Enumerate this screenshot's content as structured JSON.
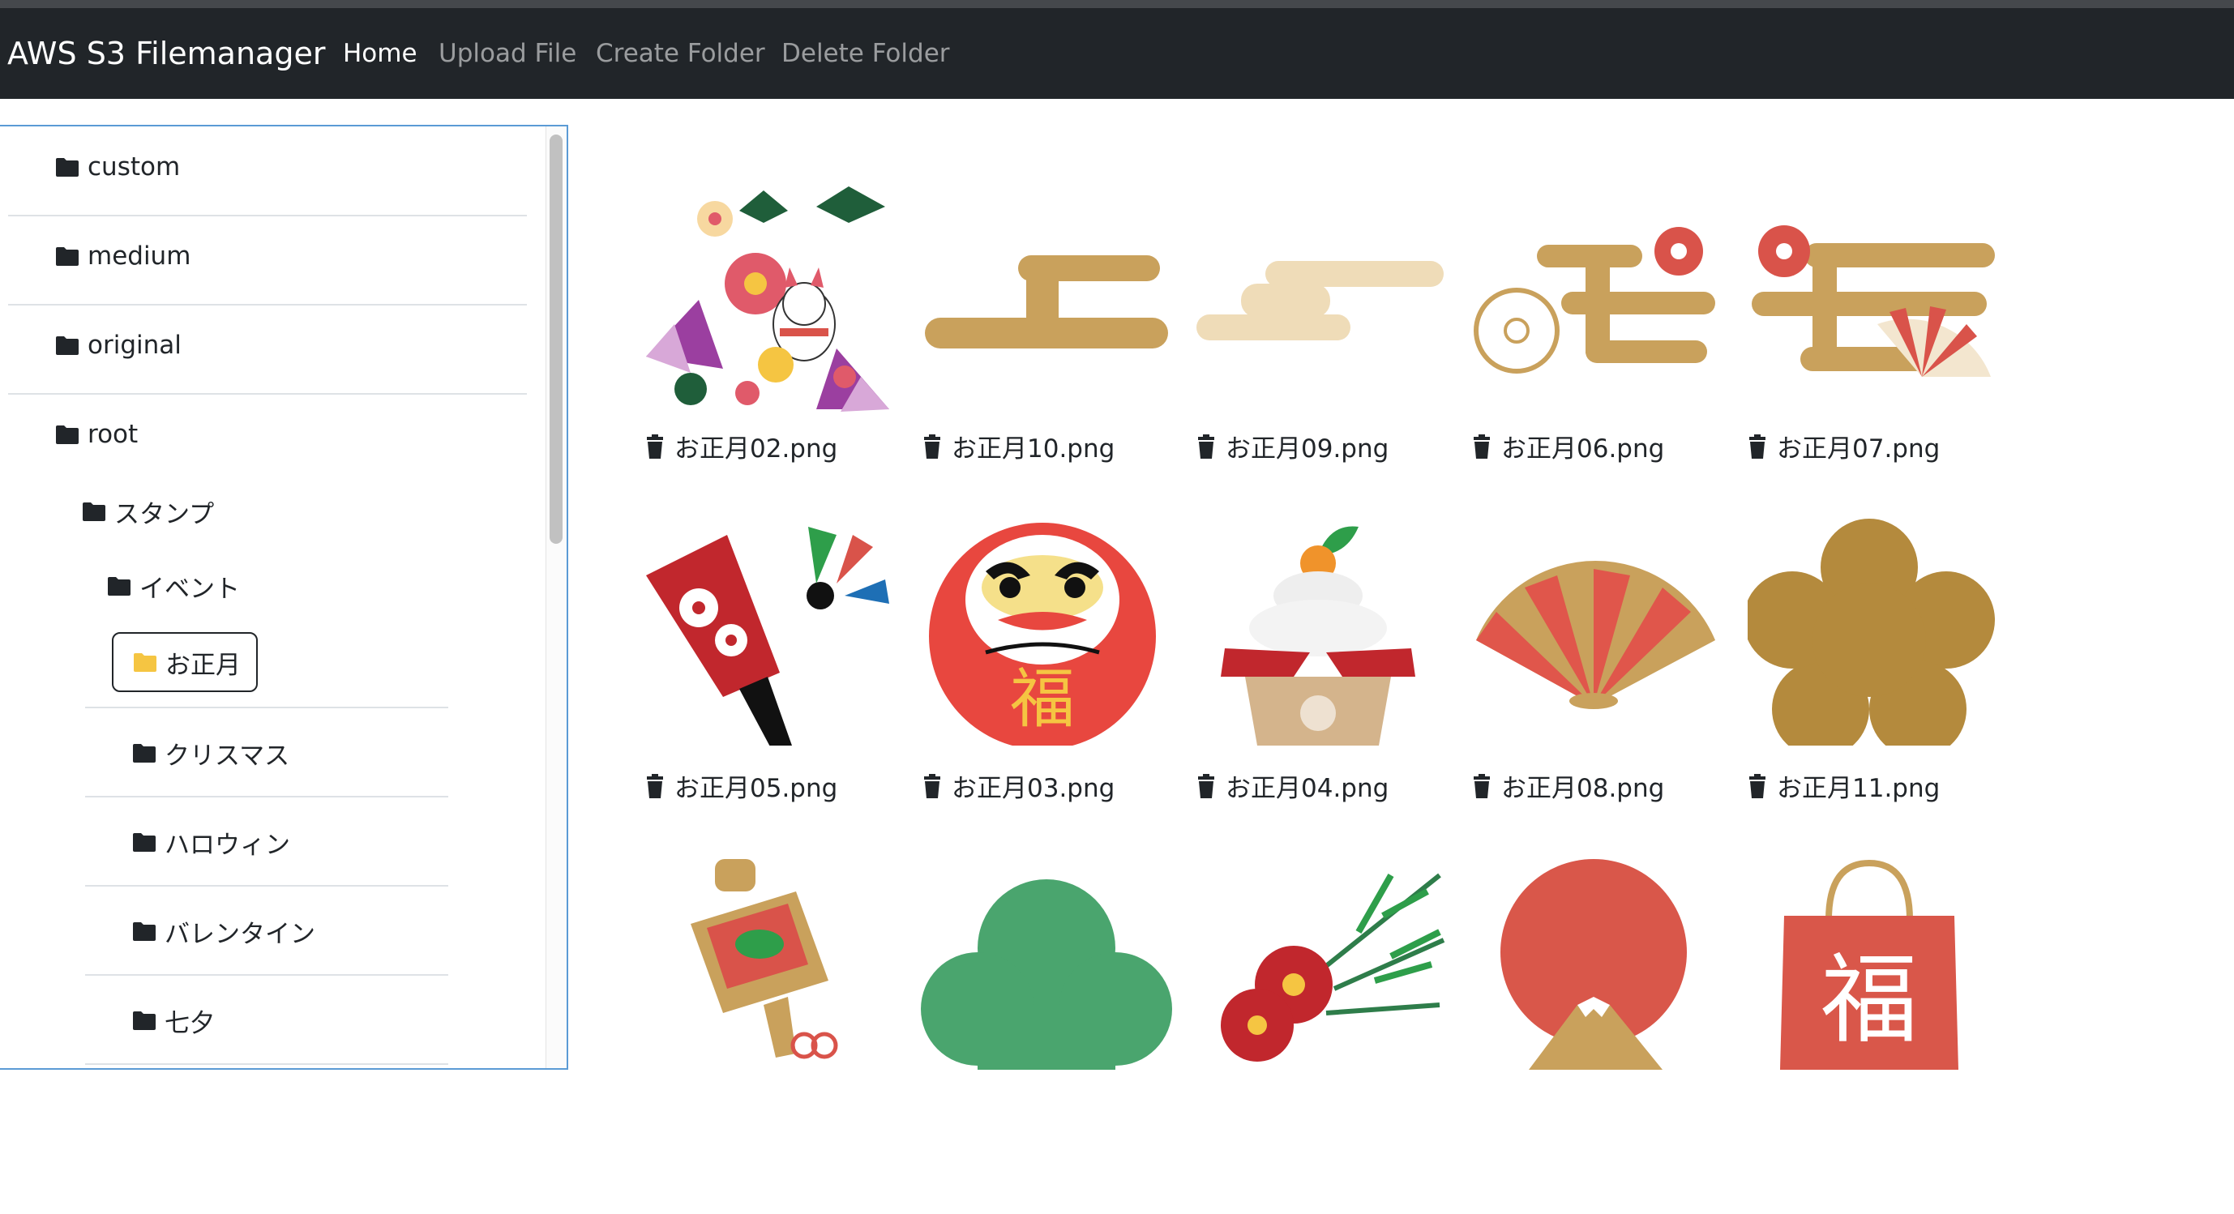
{
  "navbar": {
    "brand": "AWS S3 Filemanager",
    "links": [
      {
        "label": "Home",
        "active": true
      },
      {
        "label": "Upload File",
        "active": false
      },
      {
        "label": "Create Folder",
        "active": false
      },
      {
        "label": "Delete Folder",
        "active": false
      }
    ]
  },
  "sidebar": {
    "folders": [
      {
        "label": "custom",
        "icon": "folder-icon"
      },
      {
        "label": "medium",
        "icon": "folder-icon"
      },
      {
        "label": "original",
        "icon": "folder-icon"
      },
      {
        "label": "root",
        "icon": "folder-icon"
      },
      {
        "label": "スタンプ",
        "icon": "folder-icon"
      },
      {
        "label": "イベント",
        "icon": "folder-icon"
      },
      {
        "label": "お正月",
        "icon": "folder-open-icon",
        "selected": true
      },
      {
        "label": "クリスマス",
        "icon": "folder-icon"
      },
      {
        "label": "ハロウィン",
        "icon": "folder-icon"
      },
      {
        "label": "バレンタイン",
        "icon": "folder-icon"
      },
      {
        "label": "七夕",
        "icon": "folder-icon"
      }
    ]
  },
  "files": [
    {
      "name": "お正月02.png",
      "image": "new-year-collage-icon"
    },
    {
      "name": "お正月10.png",
      "image": "gold-cloud-icon"
    },
    {
      "name": "お正月09.png",
      "image": "beige-cloud-icon"
    },
    {
      "name": "お正月06.png",
      "image": "cloud-plum-icon"
    },
    {
      "name": "お正月07.png",
      "image": "cloud-fan-icon"
    },
    {
      "name": "お正月05.png",
      "image": "hagoita-icon"
    },
    {
      "name": "お正月03.png",
      "image": "daruma-icon"
    },
    {
      "name": "お正月04.png",
      "image": "kagami-mochi-icon"
    },
    {
      "name": "お正月08.png",
      "image": "folding-fan-icon"
    },
    {
      "name": "お正月11.png",
      "image": "plum-blossom-icon"
    },
    {
      "name": "",
      "image": "lucky-mallet-icon"
    },
    {
      "name": "",
      "image": "green-pine-icon"
    },
    {
      "name": "",
      "image": "pine-plum-icon"
    },
    {
      "name": "",
      "image": "sunrise-fuji-icon"
    },
    {
      "name": "",
      "image": "lucky-bag-icon"
    }
  ],
  "lucky_bag_text": "福",
  "daruma_text": "福",
  "colors": {
    "navbar": "#212529",
    "selected_border": "#5b9bd5",
    "gold": "#c9a15c",
    "red": "#d9534a",
    "green": "#4aa56e"
  }
}
